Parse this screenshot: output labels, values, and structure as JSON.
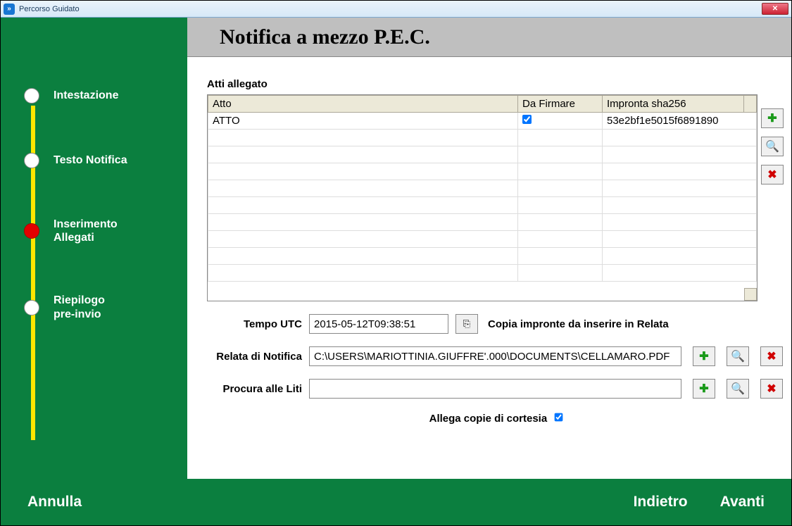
{
  "window": {
    "title": "Percorso Guidato"
  },
  "header": {
    "title": "Notifica a mezzo P.E.C."
  },
  "sidebar": {
    "steps": [
      {
        "label": "Intestazione"
      },
      {
        "label": "Testo Notifica"
      },
      {
        "label": "Inserimento\nAllegati"
      },
      {
        "label": "Riepilogo\npre-invio"
      }
    ]
  },
  "attachments": {
    "title": "Atti allegato",
    "columns": {
      "atto": "Atto",
      "firmare": "Da Firmare",
      "impronta": "Impronta sha256"
    },
    "rows": [
      {
        "atto": "ATTO",
        "firmare": true,
        "impronta": "53e2bf1e5015f6891890"
      }
    ]
  },
  "utc": {
    "label": "Tempo UTC",
    "value": "2015-05-12T09:38:51",
    "copy_hint": "Copia impronte da inserire in Relata"
  },
  "relata": {
    "label": "Relata di Notifica",
    "value": "C:\\USERS\\MARIOTTINIA.GIUFFRE'.000\\DOCUMENTS\\CELLAMARO.PDF"
  },
  "procura": {
    "label": "Procura alle Liti",
    "value": ""
  },
  "cortesia": {
    "label": "Allega copie di cortesia",
    "checked": true
  },
  "footer": {
    "cancel": "Annulla",
    "back": "Indietro",
    "next": "Avanti"
  }
}
